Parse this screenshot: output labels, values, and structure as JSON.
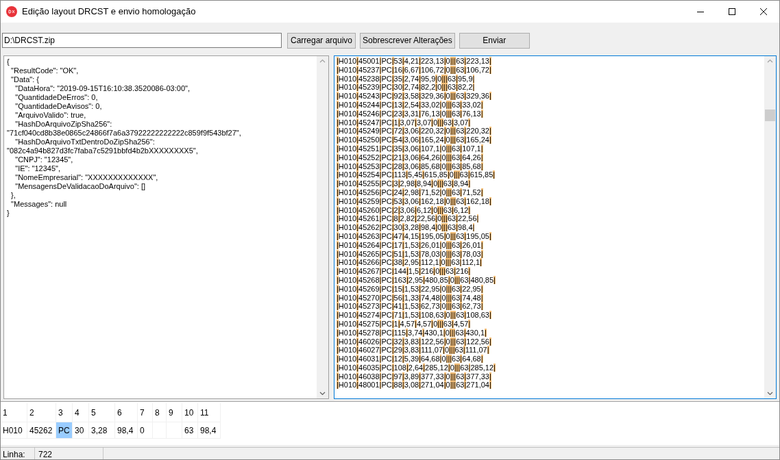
{
  "window": {
    "title": "Edição layout DRCST e envio homologação"
  },
  "toolbar": {
    "file_path": "D:\\DRCST.zip",
    "buttons": [
      "Carregar arquivo",
      "Sobrescrever Alterações",
      "Enviar"
    ]
  },
  "json_panel": {
    "lines": [
      "{",
      "  \"ResultCode\": \"OK\",",
      "  \"Data\": {",
      "    \"DataHora\": \"2019-09-15T16:10:38.3520086-03:00\",",
      "    \"QuantidadeDeErros\": 0,",
      "    \"QuantidadeDeAvisos\": 0,",
      "    \"ArquivoValido\": true,",
      "    \"HashDoArquivoZipSha256\":",
      "\"71cf040cd8b38e0865c24866f7a6a37922222222222c859f9f543bf27\",",
      "    \"HashDoArquivoTxtDentroDoZipSha256\":",
      "\"082c4a94b827d3fc7faba7c5291bbfd4b2bXXXXXXXX5\",",
      "    \"CNPJ\": \"12345\",",
      "    \"IE\": \"12345\",",
      "    \"NomeEmpresarial\": \"XXXXXXXXXXXXX\",",
      "    \"MensagensDeValidacaoDoArquivo\": []",
      "  },",
      "  \"Messages\": null",
      "}"
    ]
  },
  "records_panel": {
    "lines": [
      "|H010|45001|PC|53|4,21|223,13|0|||63|223,13|",
      "|H010|45237|PC|16|6,67|106,72|0|||63|106,72|",
      "|H010|45238|PC|35|2,74|95,9|0|||63|95,9|",
      "|H010|45239|PC|30|2,74|82,2|0|||63|82,2|",
      "|H010|45243|PC|92|3,58|329,36|0|||63|329,36|",
      "|H010|45244|PC|13|2,54|33,02|0|||63|33,02|",
      "|H010|45246|PC|23|3,31|76,13|0|||63|76,13|",
      "|H010|45247|PC|1|3,07|3,07|0|||63|3,07|",
      "|H010|45249|PC|72|3,06|220,32|0|||63|220,32|",
      "|H010|45250|PC|54|3,06|165,24|0|||63|165,24|",
      "|H010|45251|PC|35|3,06|107,1|0|||63|107,1|",
      "|H010|45252|PC|21|3,06|64,26|0|||63|64,26|",
      "|H010|45253|PC|28|3,06|85,68|0|||63|85,68|",
      "|H010|45254|PC|113|5,45|615,85|0|||63|615,85|",
      "|H010|45255|PC|3|2,98|8,94|0|||63|8,94|",
      "|H010|45256|PC|24|2,98|71,52|0|||63|71,52|",
      "|H010|45259|PC|53|3,06|162,18|0|||63|162,18|",
      "|H010|45260|PC|2|3,06|6,12|0|||63|6,12|",
      "|H010|45261|PC|8|2,82|22,56|0|||63|22,56|",
      "|H010|45262|PC|30|3,28|98,4|0|||63|98,4|",
      "|H010|45263|PC|47|4,15|195,05|0|||63|195,05|",
      "|H010|45264|PC|17|1,53|26,01|0|||63|26,01|",
      "|H010|45265|PC|51|1,53|78,03|0|||63|78,03|",
      "|H010|45266|PC|38|2,95|112,1|0|||63|112,1|",
      "|H010|45267|PC|144|1,5|216|0|||63|216|",
      "|H010|45268|PC|163|2,95|480,85|0|||63|480,85|",
      "|H010|45269|PC|15|1,53|22,95|0|||63|22,95|",
      "|H010|45270|PC|56|1,33|74,48|0|||63|74,48|",
      "|H010|45273|PC|41|1,53|62,73|0|||63|62,73|",
      "|H010|45274|PC|71|1,53|108,63|0|||63|108,63|",
      "|H010|45275|PC|1|4,57|4,57|0|||63|4,57|",
      "|H010|45278|PC|115|3,74|430,1|0|||63|430,1|",
      "|H010|46026|PC|32|3,83|122,56|0|||63|122,56|",
      "|H010|46027|PC|29|3,83|111,07|0|||63|111,07|",
      "|H010|46031|PC|12|5,39|64,68|0|||63|64,68|",
      "|H010|46035|PC|108|2,64|285,12|0|||63|285,12|",
      "|H010|46038|PC|97|3,89|377,33|0|||63|377,33|",
      "|H010|48001|PC|88|3,08|271,04|0|||63|271,04|"
    ]
  },
  "grid": {
    "columns": [
      "1",
      "2",
      "3",
      "4",
      "5",
      "6",
      "7",
      "8",
      "9",
      "10",
      "11"
    ],
    "cells": [
      {
        "text": "H010",
        "selected": false
      },
      {
        "text": "45262",
        "selected": false
      },
      {
        "text": "PC",
        "selected": true
      },
      {
        "text": "30",
        "selected": false
      },
      {
        "text": "3,28",
        "selected": false
      },
      {
        "text": "98,4",
        "selected": false
      },
      {
        "text": "0",
        "selected": false
      },
      {
        "text": "",
        "selected": false
      },
      {
        "text": "",
        "selected": false
      },
      {
        "text": "63",
        "selected": false
      },
      {
        "text": "98,4",
        "selected": false
      }
    ]
  },
  "status_bar": {
    "label": "Linha:",
    "value": "722"
  }
}
